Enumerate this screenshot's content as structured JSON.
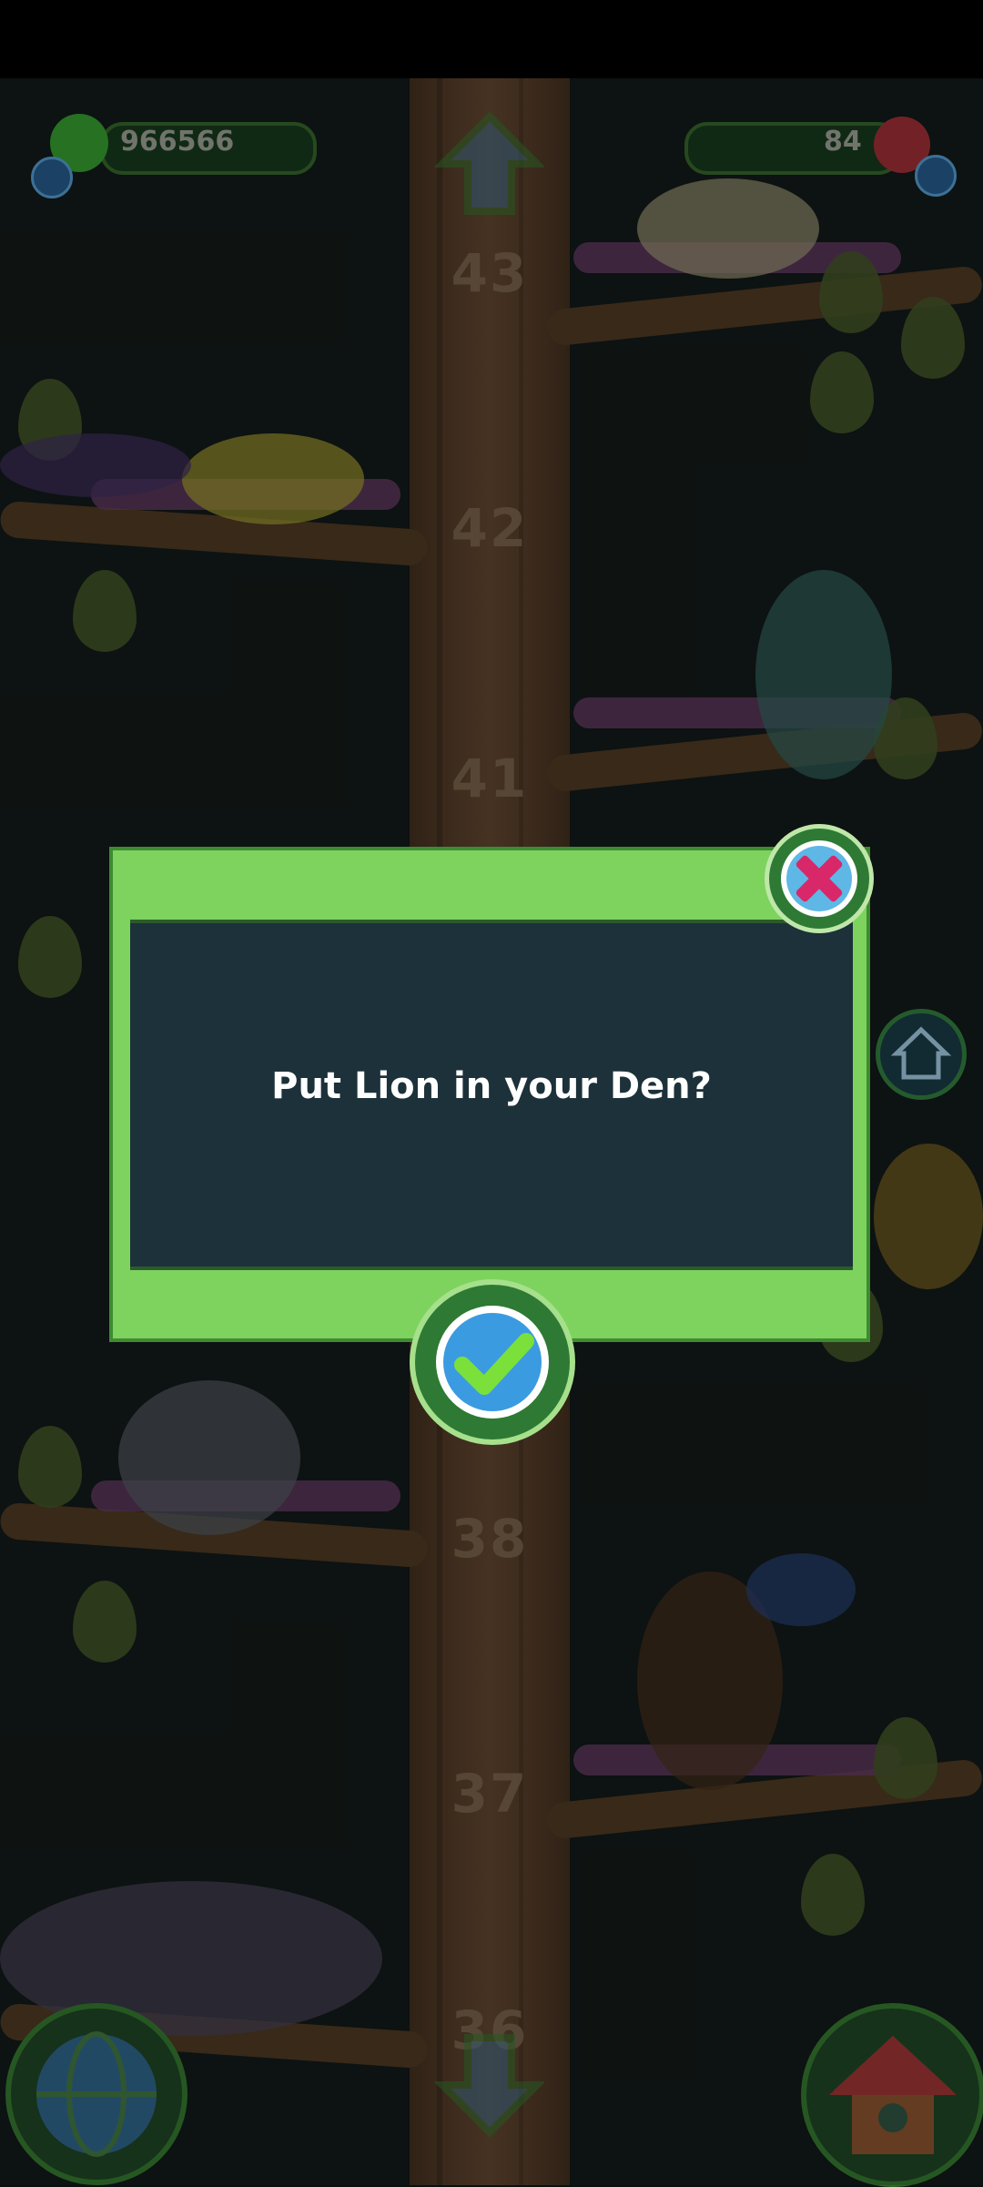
{
  "hud": {
    "coins_value": "966566",
    "gems_value": "84"
  },
  "tree": {
    "levels": [
      "43",
      "42",
      "41",
      "38",
      "37",
      "36"
    ]
  },
  "dialog": {
    "message": "Put Lion in your Den?"
  },
  "icons": {
    "close": "close-x-icon",
    "confirm": "checkmark-icon",
    "home": "home-icon",
    "globe": "globe-icon",
    "den": "den-house-icon",
    "up": "arrow-up-icon",
    "down": "arrow-down-icon"
  },
  "colors": {
    "dialog_frame": "#7dd35e",
    "dialog_panel": "#1c3139",
    "close_accent": "#d8286a",
    "confirm_accent": "#3b9be0"
  }
}
